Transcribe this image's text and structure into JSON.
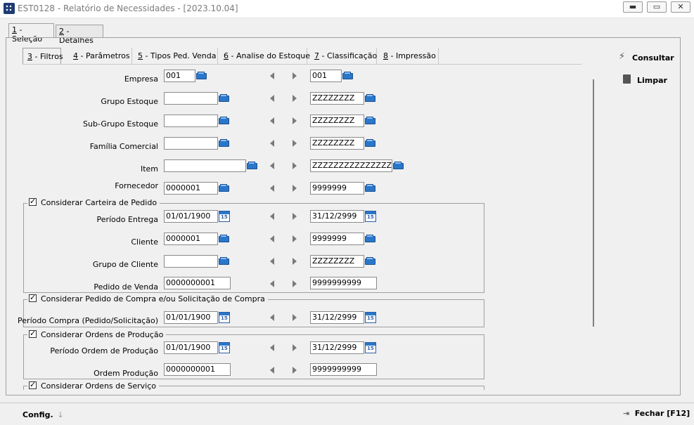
{
  "window": {
    "title": "EST0128 - Relatório de Necessidades - [2023.10.04]"
  },
  "outer_tabs": [
    {
      "key": "1",
      "rest": " - Seleção"
    },
    {
      "key": "2",
      "rest": " - Detalhes"
    }
  ],
  "inner_tabs": [
    {
      "key": "3",
      "rest": " - Filtros"
    },
    {
      "key": "4",
      "rest": " - Parâmetros"
    },
    {
      "key": "5",
      "rest": " - Tipos Ped. Venda"
    },
    {
      "key": "6",
      "rest": " - Analise do Estoque"
    },
    {
      "key": "7",
      "rest": " - Classificação"
    },
    {
      "key": "8",
      "rest": " - Impressão"
    }
  ],
  "actions": {
    "consultar": "Consultar",
    "limpar": "Limpar"
  },
  "fields": {
    "empresa": {
      "label": "Empresa",
      "from": "001",
      "to": "001"
    },
    "grupo_estoque": {
      "label": "Grupo Estoque",
      "from": "",
      "to": "ZZZZZZZZ"
    },
    "sub_grupo_estoque": {
      "label": "Sub-Grupo Estoque",
      "from": "",
      "to": "ZZZZZZZZ"
    },
    "familia_comercial": {
      "label": "Família Comercial",
      "from": "",
      "to": "ZZZZZZZZ"
    },
    "item": {
      "label": "Item",
      "from": "",
      "to": "ZZZZZZZZZZZZZZZZZZZZ"
    },
    "fornecedor": {
      "label": "Fornecedor",
      "from": "0000001",
      "to": "9999999"
    }
  },
  "group_carteira": {
    "title": "Considerar Carteira de Pedido",
    "periodo_entrega": {
      "label": "Período Entrega",
      "from": "01/01/1900",
      "to": "31/12/2999"
    },
    "cliente": {
      "label": "Cliente",
      "from": "0000001",
      "to": "9999999"
    },
    "grupo_cliente": {
      "label": "Grupo de Cliente",
      "from": "",
      "to": "ZZZZZZZZ"
    },
    "pedido_venda": {
      "label": "Pedido de Venda",
      "from": "0000000001",
      "to": "9999999999"
    }
  },
  "group_compra": {
    "title": "Considerar Pedido de Compra e/ou Solicitação de Compra",
    "periodo_compra": {
      "label": "Período Compra (Pedido/Solicitação)",
      "from": "01/01/1900",
      "to": "31/12/2999"
    }
  },
  "group_producao": {
    "title": "Considerar Ordens de Produção",
    "periodo_ordem": {
      "label": "Período Ordem de Produção",
      "from": "01/01/1900",
      "to": "31/12/2999"
    },
    "ordem_producao": {
      "label": "Ordem Produção",
      "from": "0000000001",
      "to": "9999999999"
    }
  },
  "group_servico": {
    "title": "Considerar Ordens de Serviço"
  },
  "footer": {
    "config": "Config.",
    "fechar": "Fechar [F12]"
  }
}
